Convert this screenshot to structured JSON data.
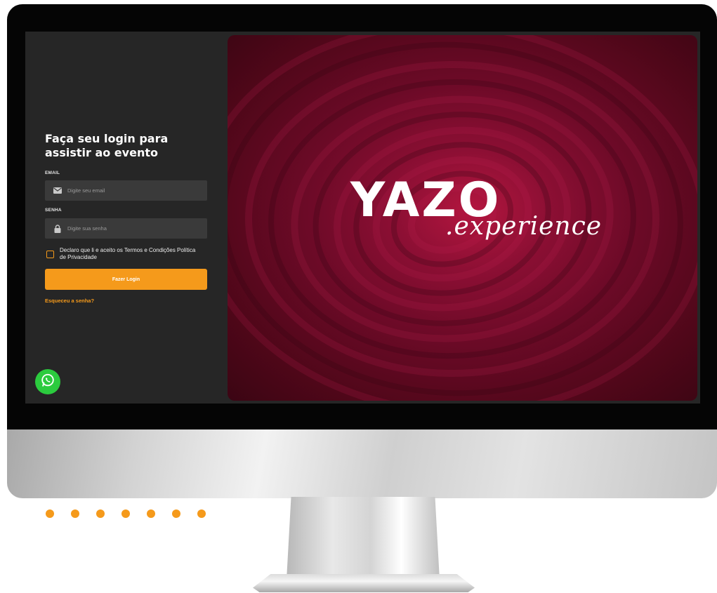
{
  "login": {
    "title": "Faça seu login para assistir ao evento",
    "email_label": "EMAIL",
    "email_placeholder": "Digite seu email",
    "password_label": "SENHA",
    "password_placeholder": "Digite sua senha",
    "terms_text": "Declaro que li e aceito os Termos e Condições Política de Privacidade",
    "login_button": "Fazer Login",
    "forgot_link": "Esqueceu a senha?"
  },
  "hero": {
    "brand": "YAZO",
    "brand_sub": ".experience"
  },
  "icons": {
    "email": "envelope-icon",
    "password": "lock-icon",
    "whatsapp": "whatsapp-icon"
  },
  "colors": {
    "accent": "#f59a1b",
    "panel": "#262626",
    "field": "#3a3a3a",
    "hero": "#7a0c2e",
    "whatsapp": "#2bcb3e"
  }
}
